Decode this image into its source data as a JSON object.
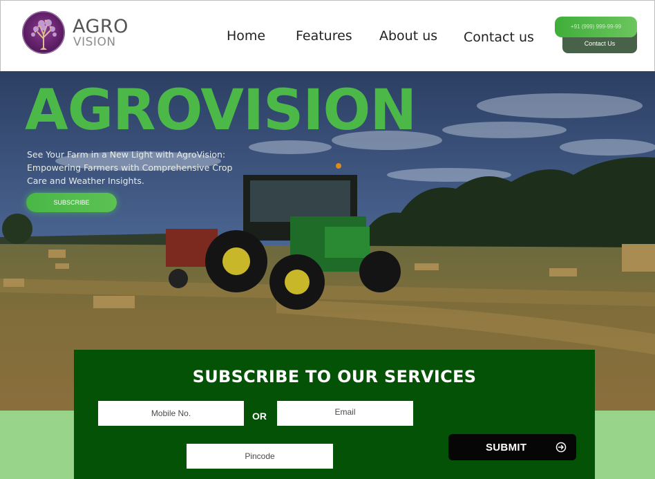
{
  "brand": {
    "name_top": "AGRO",
    "name_bottom": "VISION",
    "logo_icon": "tree-logo-icon"
  },
  "nav": {
    "items": [
      {
        "label": "Home"
      },
      {
        "label": "Features"
      },
      {
        "label": "About us"
      },
      {
        "label": "Contact us"
      }
    ]
  },
  "header_actions": {
    "phone": "+91 (999) 999-99-99",
    "contact_label": "Contact Us"
  },
  "hero": {
    "title": "AGROVISION",
    "subtitle": "See Your Farm in a New Light with AgroVision: Empowering Farmers with Comprehensive Crop Care and Weather Insights.",
    "cta_label": "SUBSCRIBE",
    "background": "tractor-in-field-photo"
  },
  "subscribe": {
    "title": "SUBSCRIBE TO OUR SERVICES",
    "mobile_placeholder": "Mobile No.",
    "or_label": "OR",
    "email_placeholder": "Email",
    "pincode_placeholder": "Pincode",
    "submit_label": "SUBMIT",
    "submit_icon": "arrow-circle-right-icon"
  },
  "colors": {
    "accent_green": "#4cb848",
    "panel_green": "#045205",
    "band_green": "#98d48a",
    "contact_button": "#486149",
    "submit_button": "#060606"
  }
}
